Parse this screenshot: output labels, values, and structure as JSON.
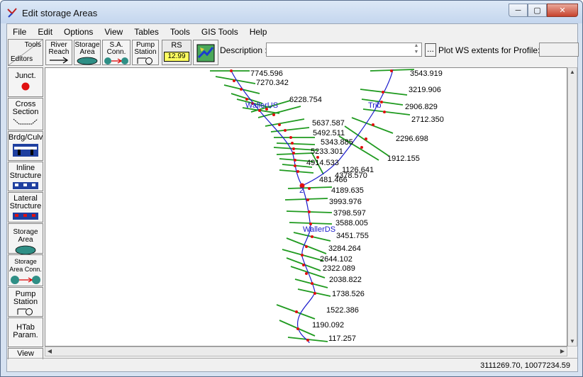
{
  "window": {
    "title": "Edit storage Areas",
    "minimize": "─",
    "maximize": "▢",
    "close": "✕"
  },
  "menu": [
    "File",
    "Edit",
    "Options",
    "View",
    "Tables",
    "Tools",
    "GIS Tools",
    "Help"
  ],
  "toolbar": {
    "corner_tools": "Tools",
    "corner_editors": "Editors",
    "river_reach": [
      "River",
      "Reach"
    ],
    "storage_area": [
      "Storage",
      "Area"
    ],
    "sa_conn": [
      "S.A.",
      "Conn."
    ],
    "pump_station": [
      "Pump",
      "Station"
    ],
    "rs_label": "RS",
    "rs_value": "12.99",
    "description_label": "Description :",
    "description_value": "",
    "ellipsis": "...",
    "plot_ws_label": "Plot WS extents for Profile:",
    "plot_ws_value": ""
  },
  "editors": {
    "junct": "Junct.",
    "cross_section": [
      "Cross",
      "Section"
    ],
    "brdg_culv": "Brdg/Culv",
    "inline_structure": [
      "Inline",
      "Structure"
    ],
    "lateral_structure": [
      "Lateral",
      "Structure"
    ],
    "storage_area": [
      "Storage",
      "Area"
    ],
    "storage_area_conn": [
      "Storage",
      "Area Conn."
    ],
    "pump_station": [
      "Pump",
      "Station"
    ],
    "htab_param": [
      "HTab",
      "Param."
    ],
    "view": "View"
  },
  "colors": {
    "xs_line": "#1f9a1f",
    "river": "#1a1acc",
    "node": "#e01010"
  },
  "reaches": {
    "waller_us": "WallerUS",
    "trib": "Trib",
    "waller_ds": "WallerDS",
    "junction": "2"
  },
  "stations": {
    "s7745": "7745.596",
    "s7270": "7270.342",
    "s6228": "6228.754",
    "s5637": "5637.587",
    "s5492": "5492.511",
    "s5343": "5343.885",
    "s5233": "5233.301",
    "s4914": "4914.533",
    "s1126": "1126.641",
    "s4378": "4378.570",
    "s481": "481.466",
    "t3543": "3543.919",
    "t3219": "3219.906",
    "t2906": "2906.829",
    "t2712": "2712.350",
    "t2296": "2296.698",
    "t1912": "1912.155",
    "d4189": "4189.635",
    "d3993": "3993.976",
    "d3798": "3798.597",
    "d3588": "3588.005",
    "d3451": "3451.755",
    "d3284": "3284.264",
    "d2644": "2644.102",
    "d2322": "2322.089",
    "d2038": "2038.822",
    "d1738": "1738.526",
    "d1522": "1522.386",
    "d1190": "1190.092",
    "d117": "117.257"
  },
  "status": {
    "coordinates": "3111269.70, 10077234.59"
  }
}
